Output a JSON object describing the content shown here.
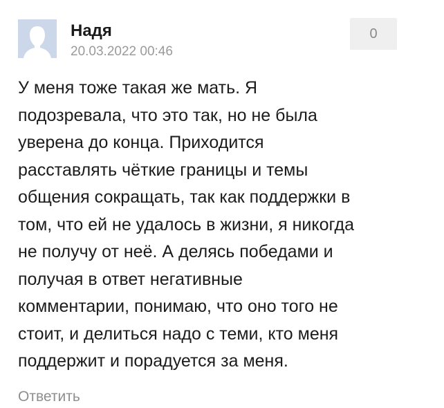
{
  "comment": {
    "author": "Надя",
    "date": "20.03.2022 00:46",
    "rating": "0",
    "text_lines": [
      "У меня тоже такая же мать. Я",
      "подозревала, что это так, но не была",
      "уверена до конца. Приходится",
      "расставлять чёткие границы и темы",
      "общения сокращать, так как поддержки в",
      "том, что ей не удалось в жизни, я никогда",
      "не получу от неё. А делясь победами и",
      "получая в ответ негативные",
      "комментарии, понимаю, что оно того не",
      "стоит, и делиться надо с теми, кто меня",
      "поддержит и порадуется за меня."
    ],
    "reply_label": "Ответить"
  },
  "colors": {
    "avatar_bg": "#cdd7ea",
    "avatar_silhouette": "#ffffff",
    "rating_bg": "#efefef",
    "muted_text": "#9a9a9a"
  },
  "icons": {
    "avatar": "user-placeholder-icon"
  }
}
